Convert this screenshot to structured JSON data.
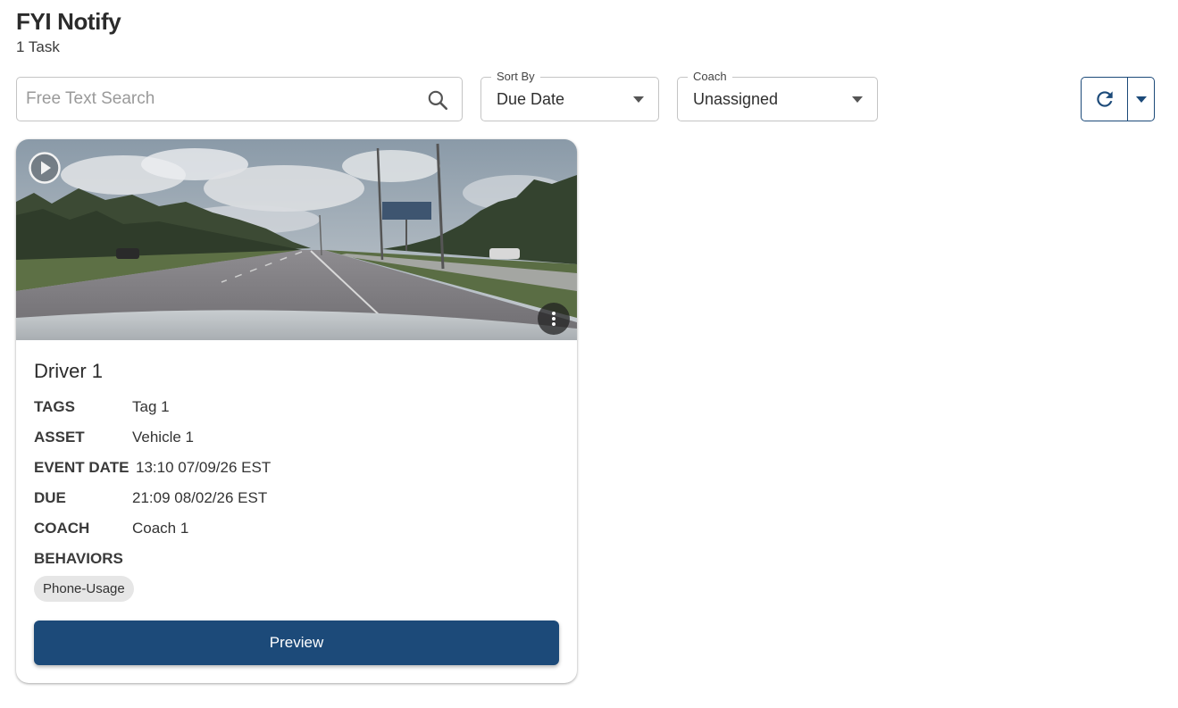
{
  "header": {
    "title": "FYI Notify",
    "task_count": "1 Task"
  },
  "search": {
    "value": "",
    "placeholder": "Free Text Search",
    "icon": "search-icon"
  },
  "sort_by": {
    "label": "Sort By",
    "selected": "Due Date"
  },
  "coach_filter": {
    "label": "Coach",
    "selected": "Unassigned"
  },
  "toolbar": {
    "refresh_icon": "refresh-icon",
    "menu_icon": "caret-down-icon",
    "accent_color": "#1c4a79"
  },
  "card": {
    "driver": "Driver 1",
    "fields": [
      {
        "label": "TAGS",
        "value": "Tag 1"
      },
      {
        "label": "ASSET",
        "value": "Vehicle 1"
      },
      {
        "label": "EVENT DATE",
        "value": "13:10 07/09/26 EST"
      },
      {
        "label": "DUE",
        "value": "21:09 08/02/26 EST"
      },
      {
        "label": "COACH",
        "value": "Coach 1"
      }
    ],
    "behaviors_label": "BEHAVIORS",
    "behaviors": [
      "Phone-Usage"
    ],
    "preview_label": "Preview",
    "thumbnail_icons": [
      "play-circle-icon",
      "more-vertical-icon"
    ],
    "button_color": "#1c4a79"
  }
}
